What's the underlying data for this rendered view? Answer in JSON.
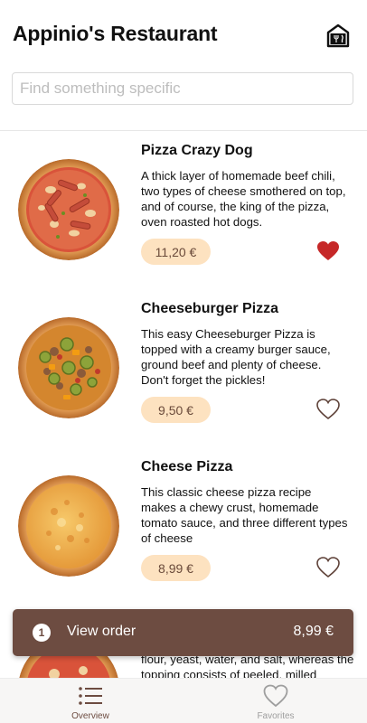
{
  "header": {
    "title": "Appinio's Restaurant",
    "icon": "restaurant-menu-icon"
  },
  "search": {
    "placeholder": "Find something specific",
    "value": ""
  },
  "menu_items": [
    {
      "name": "Pizza Crazy Dog",
      "description": "A thick layer of homemade beef chili, two types of cheese smothered on top, and of course, the king of the pizza, oven roasted hot dogs.",
      "price": "11,20 €",
      "favorite": true
    },
    {
      "name": "Cheeseburger Pizza",
      "description": "This easy Cheeseburger Pizza is topped with a creamy burger sauce, ground beef and plenty of cheese. Don't forget the pickles!",
      "price": "9,50 €",
      "favorite": false
    },
    {
      "name": "Cheese Pizza",
      "description": "This classic cheese pizza recipe makes a chewy crust, homemade tomato sauce, and three different types of cheese",
      "price": "8,99 €",
      "favorite": false
    }
  ],
  "partial_item": {
    "description": "flour, yeast, water, and salt, whereas the topping consists of peeled, milled"
  },
  "order_bar": {
    "count": "1",
    "label": "View order",
    "total": "8,99 €"
  },
  "bottom_nav": [
    {
      "label": "Overview",
      "icon": "list-icon",
      "active": true
    },
    {
      "label": "Favorites",
      "icon": "heart-outline-icon",
      "active": false
    }
  ],
  "colors": {
    "brand": "#6d4c41",
    "price_pill": "#fde2c0",
    "favorite_active": "#c62828",
    "favorite_inactive": "#5d4037"
  }
}
